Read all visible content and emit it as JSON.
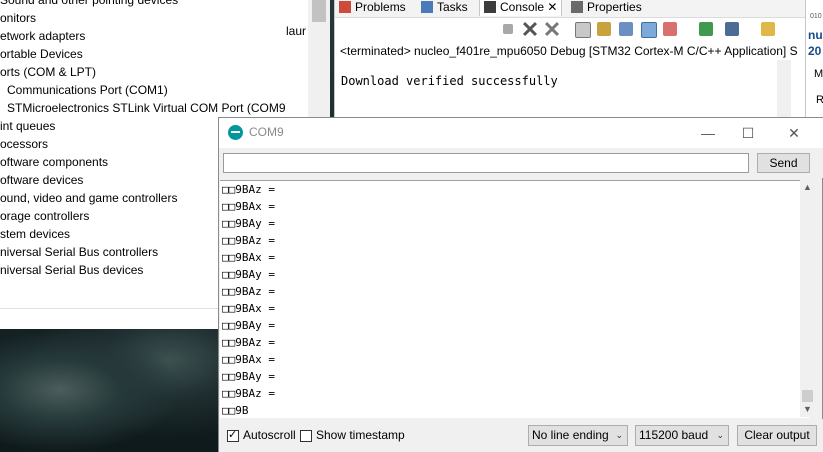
{
  "device_manager": {
    "items": [
      {
        "label": "Sound and other pointing devices",
        "child": false
      },
      {
        "label": "onitors",
        "child": false
      },
      {
        "label": "etwork adapters",
        "child": false
      },
      {
        "label": "ortable Devices",
        "child": false
      },
      {
        "label": "orts (COM & LPT)",
        "child": false
      },
      {
        "label": "Communications Port (COM1)",
        "child": true
      },
      {
        "label": "STMicroelectronics STLink Virtual COM Port (COM9)",
        "child": true
      },
      {
        "label": "int queues",
        "child": false
      },
      {
        "label": "ocessors",
        "child": false
      },
      {
        "label": "oftware components",
        "child": false
      },
      {
        "label": "oftware devices",
        "child": false
      },
      {
        "label": "ound, video and game controllers",
        "child": false
      },
      {
        "label": "orage controllers",
        "child": false
      },
      {
        "label": "stem devices",
        "child": false
      },
      {
        "label": "niversal Serial Bus controllers",
        "child": false
      },
      {
        "label": "niversal Serial Bus devices",
        "child": false
      }
    ],
    "side_text": "laur"
  },
  "eclipse": {
    "tabs": [
      {
        "label": "Problems",
        "color": "#d04a3a"
      },
      {
        "label": "Tasks",
        "color": "#4a7ab8"
      },
      {
        "label": "Console ✕",
        "color": "#3c3c3c"
      },
      {
        "label": "Properties",
        "color": "#6a6a6a"
      }
    ],
    "terminated_text": "<terminated> nucleo_f401re_mpu6050 Debug [STM32 Cortex-M C/C++ Application] S",
    "console_text": "Download verified successfully"
  },
  "right_panel": {
    "line1": "nu",
    "line2": "20",
    "line3": "M",
    "line4": "R"
  },
  "serial_monitor": {
    "title": "COM9",
    "minimize": "—",
    "maximize": "☐",
    "close": "✕",
    "send_label": "Send",
    "send_value": "",
    "lines": [
      "□□9BAz =",
      "□□9BAx =",
      "□□9BAy =",
      "□□9BAz =",
      "□□9BAx =",
      "□□9BAy =",
      "□□9BAz =",
      "□□9BAx =",
      "□□9BAy =",
      "□□9BAz =",
      "□□9BAx =",
      "□□9BAy =",
      "□□9BAz =",
      "□□9B"
    ],
    "autoscroll_label": "Autoscroll",
    "autoscroll_checked": true,
    "timestamp_label": "Show timestamp",
    "timestamp_checked": false,
    "line_ending": "No line ending",
    "baud": "115200 baud",
    "clear_label": "Clear output"
  }
}
